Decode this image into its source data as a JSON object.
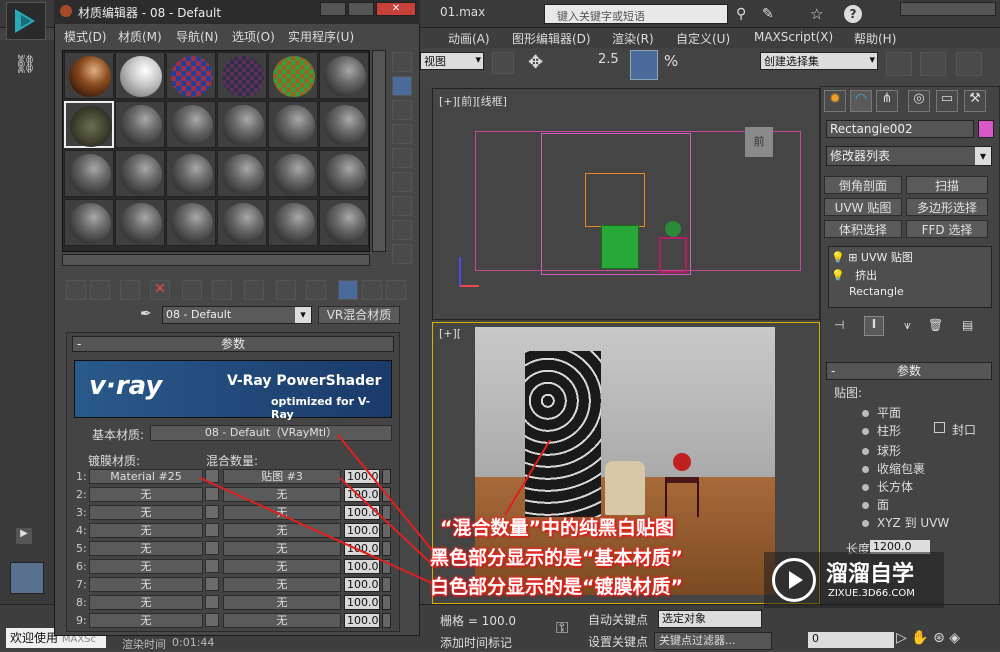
{
  "app": {
    "search_placeholder": "键入关键字或短语",
    "file_title": "01.max"
  },
  "main_menu": [
    "动画(A)",
    "图形编辑器(D)",
    "渲染(R)",
    "自定义(U)",
    "MAXScript(X)",
    "帮助(H)"
  ],
  "toolbar": {
    "view_select": "视图",
    "num_25": "2.5",
    "selection_set": "创建选择集"
  },
  "viewports": {
    "front_label": "[+][前][线框]",
    "persp_label": "[+][",
    "nav_cube_front": "前"
  },
  "material_editor": {
    "title": "材质编辑器 - 08 - Default",
    "menu": [
      "模式(D)",
      "材质(M)",
      "导航(N)",
      "选项(O)",
      "实用程序(U)"
    ],
    "current_material": "08 - Default",
    "material_type": "VR混合材质",
    "rollout_title": "参数",
    "banner_logo": "v·ray",
    "banner_title": "V-Ray PowerShader",
    "banner_sub": "optimized for V-Ray",
    "base_label": "基本材质:",
    "base_value": "08 - Default（VRayMtl）",
    "coat_header": "镀膜材质:",
    "blend_header": "混合数量:",
    "rows": [
      {
        "num": "1:",
        "mat": "Material #25",
        "map": "贴图 #3",
        "amt": "100.0"
      },
      {
        "num": "2:",
        "mat": "无",
        "map": "无",
        "amt": "100.0"
      },
      {
        "num": "3:",
        "mat": "无",
        "map": "无",
        "amt": "100.0"
      },
      {
        "num": "4:",
        "mat": "无",
        "map": "无",
        "amt": "100.0"
      },
      {
        "num": "5:",
        "mat": "无",
        "map": "无",
        "amt": "100.0"
      },
      {
        "num": "6:",
        "mat": "无",
        "map": "无",
        "amt": "100.0"
      },
      {
        "num": "7:",
        "mat": "无",
        "map": "无",
        "amt": "100.0"
      },
      {
        "num": "8:",
        "mat": "无",
        "map": "无",
        "amt": "100.0"
      },
      {
        "num": "9:",
        "mat": "无",
        "map": "无",
        "amt": "100.0"
      }
    ]
  },
  "command_panel": {
    "object_name": "Rectangle002",
    "object_color": "#d858c8",
    "modifier_list": "修改器列表",
    "buttons": [
      "倒角剖面",
      "扫描",
      "UVW 贴图",
      "多边形选择",
      "体积选择",
      "FFD 选择"
    ],
    "stack": [
      "UVW 贴图",
      "挤出",
      "Rectangle"
    ],
    "params_title": "参数",
    "mapping_label": "贴图:",
    "mapping_options": [
      "平面",
      "柱形",
      "球形",
      "收缩包裹",
      "长方体",
      "面",
      "XYZ 到 UVW"
    ],
    "cap_label": "封口",
    "length_label": "长度:",
    "length_value": "1200.0"
  },
  "status": {
    "welcome": "欢迎使用",
    "maxsc": "MAXSc",
    "render_time": "渲染时间",
    "time_value": "0:01:44",
    "grid": "栅格 = 100.0",
    "add_tag": "添加时间标记",
    "auto_key": "自动关键点",
    "selected": "选定对象",
    "set_key": "设置关键点",
    "key_filter": "关键点过滤器...",
    "frame": "0"
  },
  "annotation": {
    "line1": "“混合数量”中的纯黑白贴图",
    "line2": "黑色部分显示的是“基本材质”",
    "line3": "白色部分显示的是“镀膜材质”"
  },
  "watermark": {
    "brand": "溜溜自学",
    "url": "ZIXUE.3D66.COM"
  }
}
